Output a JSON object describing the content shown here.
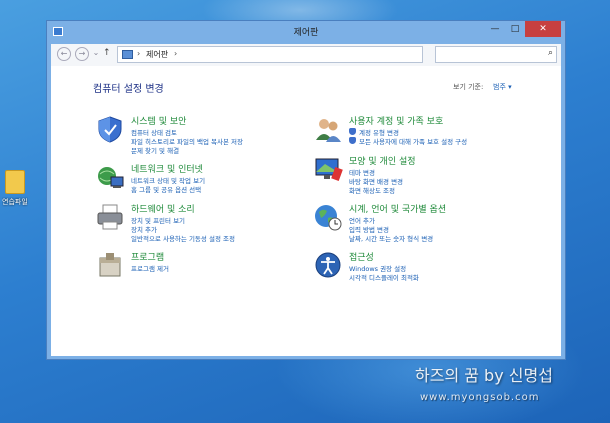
{
  "desktop": {
    "folder_label": "연습파일"
  },
  "window": {
    "title": "제어판",
    "controls": {
      "minimize": "—",
      "maximize": "□",
      "close": "✕"
    }
  },
  "address": {
    "back": "←",
    "forward": "→",
    "up": "↑",
    "separator": "›",
    "crumb": "제어판",
    "dropdown": "⌄",
    "refresh": "↻",
    "search_placeholder": "",
    "search_icon": "⌕"
  },
  "main": {
    "heading": "컴퓨터 설정 변경",
    "view_by_label": "보기 기준:",
    "view_by_value": "범주 ▾"
  },
  "categories": [
    {
      "icon": "system-security-icon",
      "title": "시스템 및 보안",
      "links": [
        "컴퓨터 상태 검토",
        "파일 히스토리로 파일의 백업 복사본 저장",
        "문제 찾기 및 해결"
      ]
    },
    {
      "icon": "network-icon",
      "title": "네트워크 및 인터넷",
      "links": [
        "네트워크 상태 및 작업 보기",
        "홈 그룹 및 공유 옵션 선택"
      ]
    },
    {
      "icon": "printer-icon",
      "title": "하드웨어 및 소리",
      "links": [
        "장치 및 프린터 보기",
        "장치 추가",
        "일반적으로 사용하는 기동성 설정 조정"
      ]
    },
    {
      "icon": "programs-icon",
      "title": "프로그램",
      "links": [
        "프로그램 제거"
      ]
    },
    {
      "icon": "user-accounts-icon",
      "title": "사용자 계정 및 가족 보호",
      "links": [
        "계정 유형 변경",
        "모든 사용자에 대해 가족 보호 설정 구성"
      ]
    },
    {
      "icon": "appearance-icon",
      "title": "모양 및 개인 설정",
      "links": [
        "테마 변경",
        "바탕 화면 배경 변경",
        "화면 해상도 조정"
      ]
    },
    {
      "icon": "globe-clock-icon",
      "title": "시계, 언어 및 국가별 옵션",
      "links": [
        "언어 추가",
        "입력 방법 변경",
        "날짜, 시간 또는 숫자 형식 변경"
      ]
    },
    {
      "icon": "accessibility-icon",
      "title": "접근성",
      "links": [
        "Windows 권장 설정",
        "시각적 디스플레이 최적화"
      ]
    }
  ],
  "watermark": {
    "text": "하즈의 꿈 by 신명섭",
    "url": "www.myongsob.com"
  }
}
